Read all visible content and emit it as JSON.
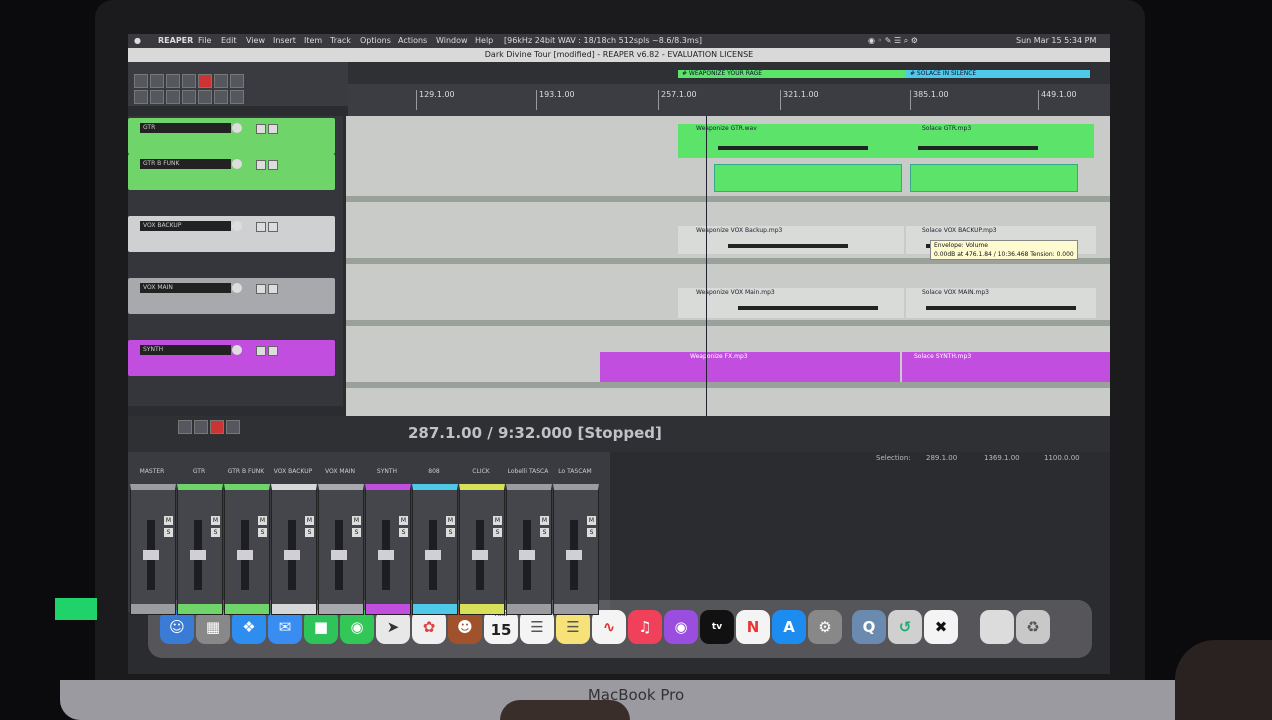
{
  "menubar": {
    "app": "REAPER",
    "items": [
      "File",
      "Edit",
      "View",
      "Insert",
      "Item",
      "Track",
      "Options",
      "Actions",
      "Window",
      "Help"
    ],
    "status": "[96kHz 24bit WAV : 18/18ch 512spls ~8.6/8.3ms]",
    "clock": "Sun Mar 15 5:34 PM"
  },
  "window": {
    "title": "Dark Divine Tour [modified] - REAPER v6.82 - EVALUATION LICENSE"
  },
  "regions": {
    "green": "# WEAPONIZE YOUR RAGE",
    "cyan": "# SOLACE IN SILENCE"
  },
  "ruler": {
    "ticks": [
      "129.1.00",
      "193.1.00",
      "257.1.00",
      "321.1.00",
      "385.1.00",
      "449.1.00"
    ]
  },
  "tracks": [
    {
      "name": "GTR",
      "color": "#6fd46a"
    },
    {
      "name": "GTR B FUNK",
      "color": "#6fd46a"
    },
    {
      "name": "VOX BACKUP",
      "color": "#cfd0d2"
    },
    {
      "name": "VOX MAIN",
      "color": "#a7a9ad"
    },
    {
      "name": "SYNTH",
      "color": "#c24ee0"
    }
  ],
  "items": {
    "gtr_a": "Weaponize GTR.wav",
    "gtr_b": "Solace GTR.mp3",
    "vox_backup_a": "Weaponize VOX Backup.mp3",
    "vox_backup_b": "Solace VOX BACKUP.mp3",
    "vox_main_a": "Weaponize VOX Main.mp3",
    "vox_main_b": "Solace VOX MAIN.mp3",
    "synth_a": "Weaponize FX.mp3",
    "synth_b": "Solace SYNTH.mp3"
  },
  "tooltip": {
    "line1": "Envelope: Volume",
    "line2": "0.00dB at 476.1.84 / 10:36.468 Tension: 0.000"
  },
  "transport": {
    "time": "287.1.00 / 9:32.000 [Stopped]"
  },
  "selection": {
    "label": "Selection:",
    "start": "289.1.00",
    "end": "1369.1.00",
    "length": "1100.0.00"
  },
  "mixer": {
    "strips": [
      {
        "name": "MASTER",
        "color": "#9a9ca0"
      },
      {
        "name": "GTR",
        "color": "#6fd46a"
      },
      {
        "name": "GTR B FUNK",
        "color": "#6fd46a"
      },
      {
        "name": "VOX BACKUP",
        "color": "#d6d7d9"
      },
      {
        "name": "VOX MAIN",
        "color": "#a7a9ad"
      },
      {
        "name": "SYNTH",
        "color": "#c24ee0"
      },
      {
        "name": "808",
        "color": "#4fc9e8"
      },
      {
        "name": "CLICK",
        "color": "#d8e05a"
      },
      {
        "name": "Lobelli TASCA",
        "color": "#9a9ca0"
      },
      {
        "name": "Lo TASCAM",
        "color": "#9a9ca0"
      }
    ],
    "mute": "M",
    "solo": "S"
  },
  "dock": {
    "calendar_month": "MAR",
    "calendar_day": "15",
    "tv_label": "tv"
  },
  "laptop": {
    "brand": "MacBook Pro"
  },
  "colors": {
    "green": "#5be36a",
    "purple": "#c24ee0",
    "cyan": "#4fc9e8"
  }
}
